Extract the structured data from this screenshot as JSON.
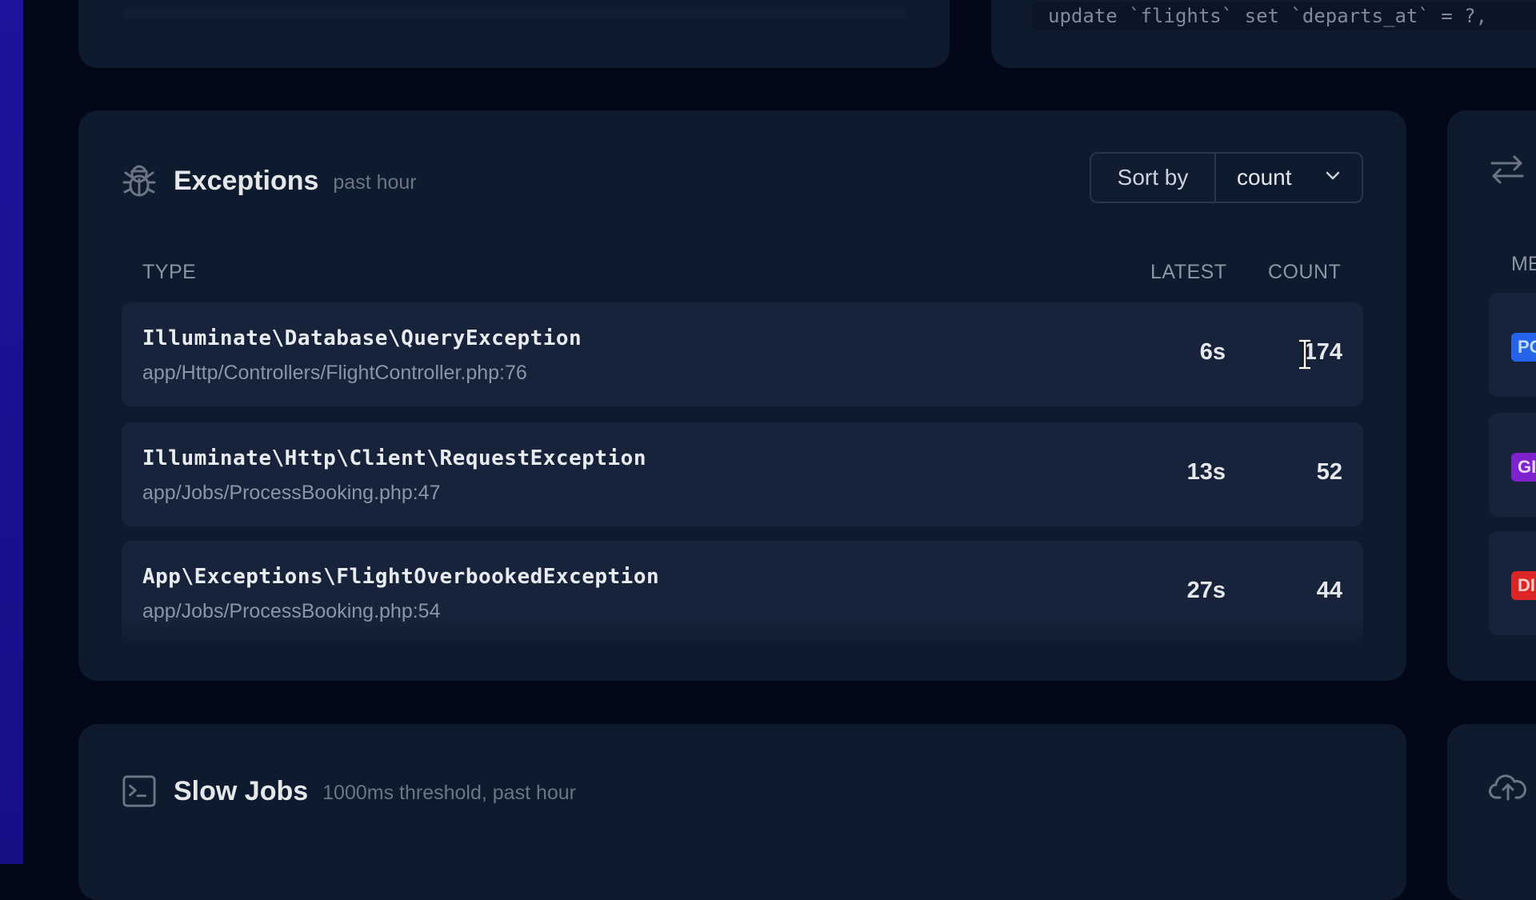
{
  "top_right_card": {
    "sql_snippet": "update `flights` set `departs_at` = ?,"
  },
  "exceptions": {
    "title": "Exceptions",
    "subtitle": "past hour",
    "icon": "bug-icon",
    "sort": {
      "label": "Sort by",
      "value": "count"
    },
    "columns": {
      "type": "TYPE",
      "latest": "LATEST",
      "count": "COUNT"
    },
    "rows": [
      {
        "type": "Illuminate\\Database\\QueryException",
        "location": "app/Http/Controllers/FlightController.php:76",
        "latest": "6s",
        "count": "174"
      },
      {
        "type": "Illuminate\\Http\\Client\\RequestException",
        "location": "app/Jobs/ProcessBooking.php:47",
        "latest": "13s",
        "count": "52"
      },
      {
        "type": "App\\Exceptions\\FlightOverbookedException",
        "location": "app/Jobs/ProcessBooking.php:54",
        "latest": "27s",
        "count": "44"
      }
    ]
  },
  "requests_card": {
    "icon": "swap-arrows-icon",
    "column_fragment": "ME",
    "method_badges": [
      {
        "text": "PO",
        "color": "#2563eb",
        "text_color": "#bfdbfe"
      },
      {
        "text": "GI",
        "color": "#7e22ce",
        "text_color": "#e9d5ff"
      },
      {
        "text": "DI",
        "color": "#dc2626",
        "text_color": "#fecaca"
      }
    ]
  },
  "slow_jobs": {
    "title": "Slow Jobs",
    "subtitle": "1000ms threshold, past hour",
    "icon": "terminal-icon"
  },
  "bottom_right_card": {
    "icon": "cloud-upload-icon"
  }
}
